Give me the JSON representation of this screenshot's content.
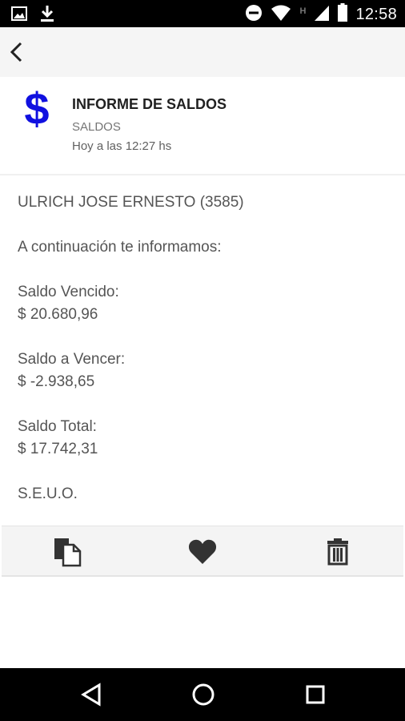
{
  "status_bar": {
    "time": "12:58",
    "network_type": "H",
    "icons": [
      "image-icon",
      "download-icon",
      "do-not-disturb-icon",
      "wifi-icon",
      "signal-icon",
      "battery-icon"
    ]
  },
  "toolbar": {
    "back_icon": "chevron-left-icon"
  },
  "message": {
    "icon": "dollar-icon",
    "icon_color": "#1010e0",
    "title": "INFORME DE SALDOS",
    "category": "SALDOS",
    "time": "Hoy a las 12:27 hs"
  },
  "body": {
    "client": "ULRICH JOSE ERNESTO (3585)",
    "intro": "A continuación te informamos:",
    "saldo_vencido_label": "Saldo Vencido:",
    "saldo_vencido_value": "$ 20.680,96",
    "saldo_a_vencer_label": "Saldo a Vencer:",
    "saldo_a_vencer_value": "$ -2.938,65",
    "saldo_total_label": "Saldo Total:",
    "saldo_total_value": "$ 17.742,31",
    "footer": "S.E.U.O."
  },
  "actions": [
    "copy-icon",
    "favorite-icon",
    "delete-icon"
  ],
  "nav": [
    "back-triangle-icon",
    "home-circle-icon",
    "recents-square-icon"
  ]
}
